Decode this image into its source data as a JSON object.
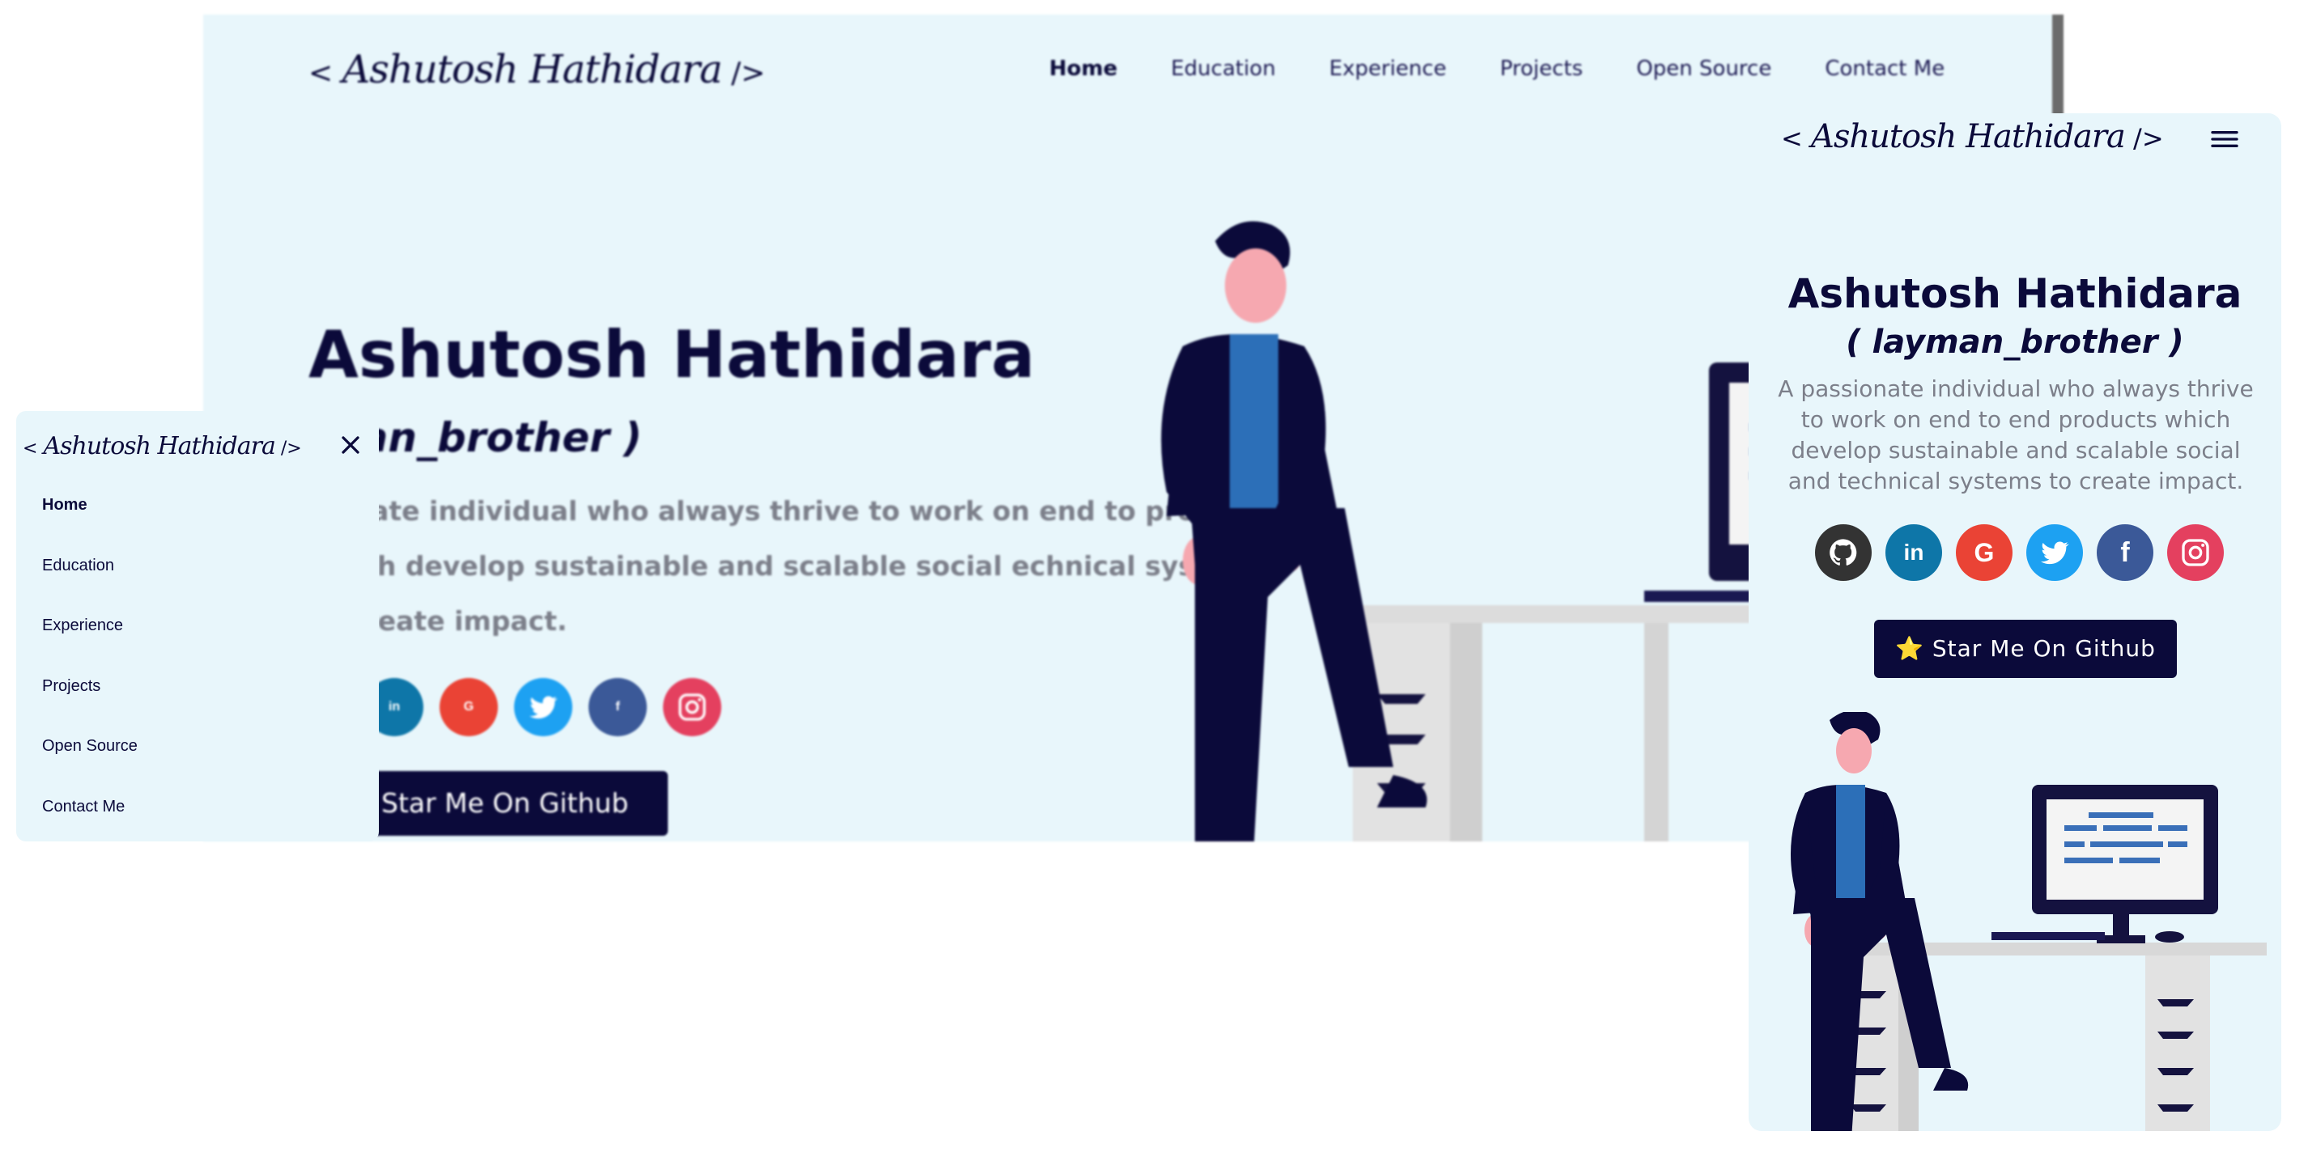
{
  "brand": {
    "logo_open": "<",
    "logo_signature": "Ashutosh Hathidara",
    "logo_close": "/>"
  },
  "desktop": {
    "nav": [
      "Home",
      "Education",
      "Experience",
      "Projects",
      "Open Source",
      "Contact Me"
    ],
    "title": "Ashutosh Hathidara",
    "subtitle": "yman_brother )",
    "desc": "sionate individual who always thrive to work on end to products which develop sustainable and scalable social echnical systems to create impact.",
    "star_button": "Star Me On Github"
  },
  "menu": {
    "items": [
      "Home",
      "Education",
      "Experience",
      "Projects",
      "Open Source",
      "Contact Me"
    ]
  },
  "mobile": {
    "title": "Ashutosh Hathidara",
    "subtitle": "( layman_brother )",
    "desc": "A passionate individual who always thrive to work on end to end products which develop sustainable and scalable social and technical systems to create impact.",
    "star_button": "⭐ Star Me On Github"
  },
  "social": [
    {
      "name": "github-icon",
      "color": "#333333"
    },
    {
      "name": "linkedin-icon",
      "color": "#0e76a8"
    },
    {
      "name": "google-icon",
      "color": "#ea4335"
    },
    {
      "name": "twitter-icon",
      "color": "#1da1f2"
    },
    {
      "name": "facebook-icon",
      "color": "#3b5998"
    },
    {
      "name": "instagram-icon",
      "color": "#e4405f"
    }
  ],
  "colors": {
    "background": "#e8f6fb",
    "primary": "#0b0a3a",
    "text_muted": "#7c7f8a"
  }
}
